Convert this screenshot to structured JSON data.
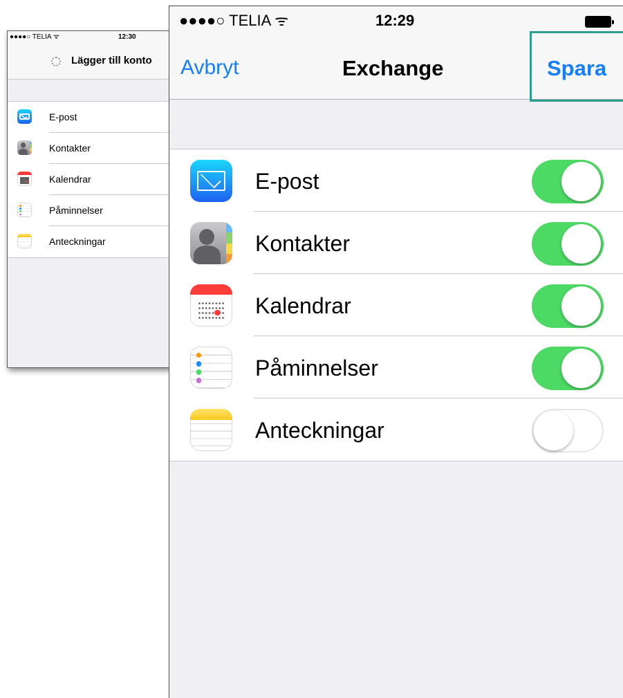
{
  "back_screenshot": {
    "status": {
      "carrier": "●●●●○ TELIA ᯤ",
      "time": "12:30"
    },
    "title": "Lägger till konto",
    "items": [
      {
        "label": "E-post",
        "icon": "mail-icon"
      },
      {
        "label": "Kontakter",
        "icon": "contacts-icon"
      },
      {
        "label": "Kalendrar",
        "icon": "calendar-icon"
      },
      {
        "label": "Påminnelser",
        "icon": "reminders-icon"
      },
      {
        "label": "Anteckningar",
        "icon": "notes-icon"
      }
    ]
  },
  "front_screenshot": {
    "status": {
      "carrier": "●●●●○ TELIA ᯤ",
      "time": "12:29",
      "battery": "battery-full-icon"
    },
    "nav": {
      "cancel": "Avbryt",
      "title": "Exchange",
      "save": "Spara"
    },
    "items": [
      {
        "label": "E-post",
        "icon": "mail-icon",
        "enabled": true
      },
      {
        "label": "Kontakter",
        "icon": "contacts-icon",
        "enabled": true
      },
      {
        "label": "Kalendrar",
        "icon": "calendar-icon",
        "enabled": true
      },
      {
        "label": "Påminnelser",
        "icon": "reminders-icon",
        "enabled": true
      },
      {
        "label": "Anteckningar",
        "icon": "notes-icon",
        "enabled": false
      }
    ]
  },
  "colors": {
    "ios_blue": "#147efb",
    "toggle_on": "#4cd964",
    "highlight_frame": "#2a9d8f",
    "group_background": "#efeff4"
  }
}
